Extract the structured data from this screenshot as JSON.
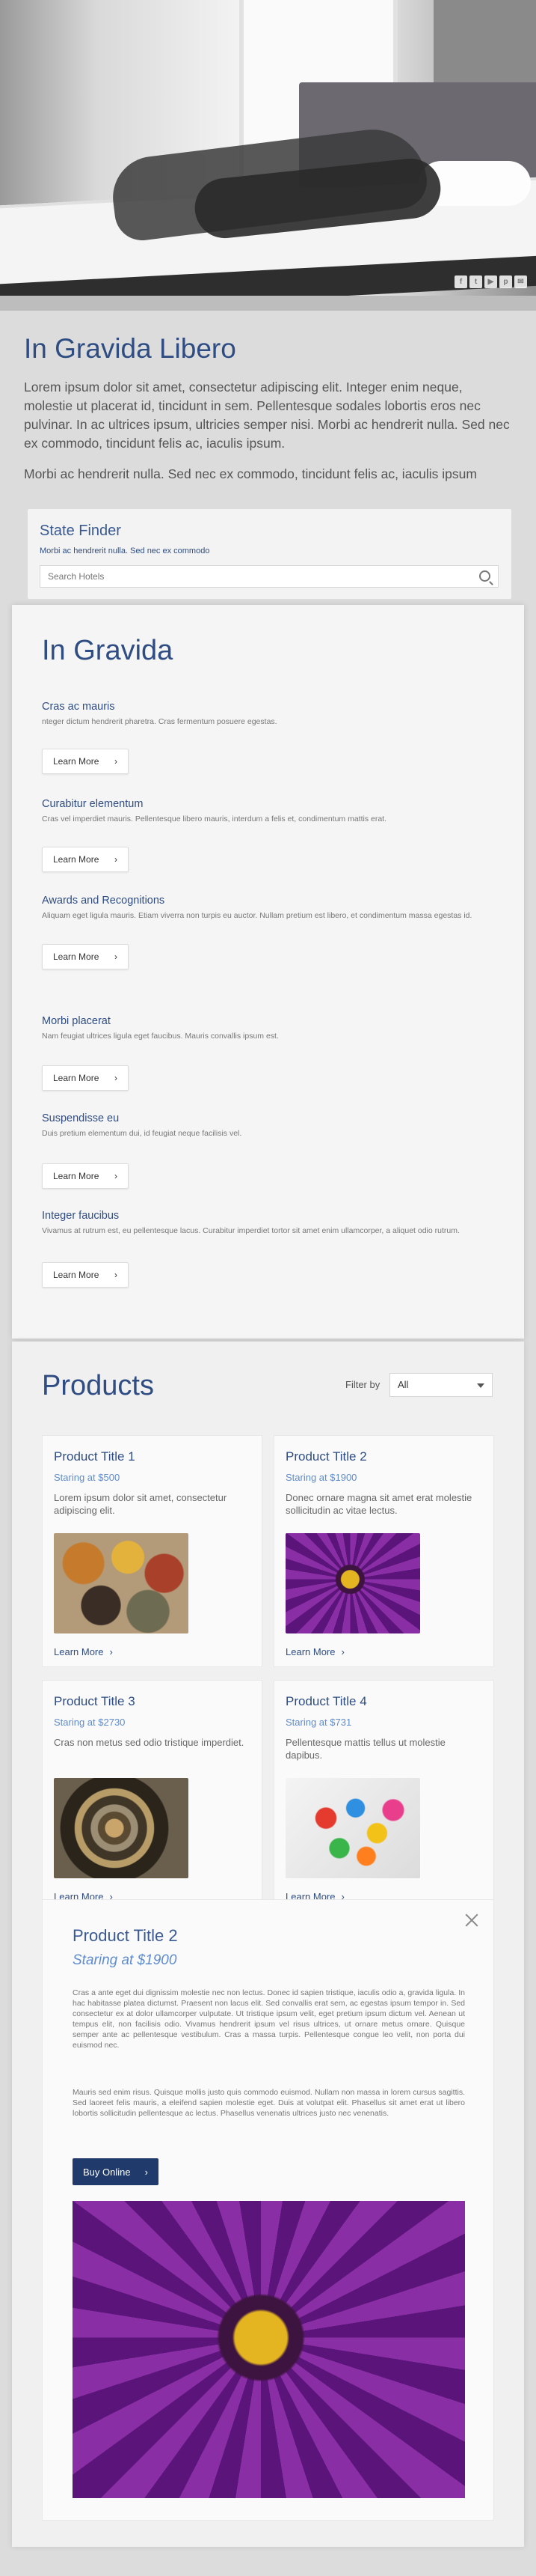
{
  "hero": {
    "social_icons": [
      "facebook-icon",
      "twitter-icon",
      "youtube-icon",
      "pinterest-icon",
      "email-icon"
    ],
    "social_glyphs": [
      "f",
      "t",
      "▶",
      "p",
      "✉"
    ]
  },
  "intro": {
    "title": "In Gravida Libero",
    "paragraph1": "Lorem ipsum dolor sit amet, consectetur adipiscing elit. Integer enim neque, molestie ut placerat id, tincidunt in sem. Pellentesque sodales lobortis eros nec pulvinar. In ac ultrices ipsum, ultricies semper nisi. Morbi ac hendrerit nulla. Sed nec ex commodo, tincidunt felis ac, iaculis ipsum.",
    "paragraph2": "Morbi ac hendrerit nulla. Sed nec ex commodo, tincidunt felis ac, iaculis ipsum"
  },
  "state_finder": {
    "title": "State Finder",
    "subtitle": "Morbi ac hendrerit nulla. Sed nec ex commodo",
    "placeholder": "Search Hotels"
  },
  "gravida": {
    "title": "In Gravida",
    "learn_more": "Learn More",
    "items": [
      {
        "title": "Cras ac mauris",
        "desc": "nteger dictum hendrerit pharetra. Cras fermentum posuere egestas."
      },
      {
        "title": "Curabitur elementum",
        "desc": "Cras vel imperdiet mauris. Pellentesque libero mauris, interdum a felis et, condimentum mattis erat."
      },
      {
        "title": "Awards and Recognitions",
        "desc": "Aliquam eget ligula mauris. Etiam viverra non turpis eu auctor. Nullam pretium est libero, et condimentum massa egestas id."
      },
      {
        "title": "Morbi placerat",
        "desc": "Nam feugiat ultrices ligula eget faucibus. Mauris convallis ipsum est."
      },
      {
        "title": "Suspendisse eu",
        "desc": "Duis pretium elementum dui, id feugiat neque facilisis vel."
      },
      {
        "title": "Integer faucibus",
        "desc": "Vivamus at rutrum est, eu pellentesque lacus. Curabitur imperdiet tortor sit amet enim ullamcorper, a aliquet odio rutrum."
      }
    ]
  },
  "products": {
    "title": "Products",
    "filter_label": "Filter by",
    "filter_value": "All",
    "learn_more": "Learn More",
    "items": [
      {
        "title": "Product Title 1",
        "price": "Staring at $500",
        "desc": "Lorem ipsum dolor sit amet, consectetur adipiscing elit.",
        "image": "spices"
      },
      {
        "title": "Product Title 2",
        "price": "Staring at $1900",
        "desc": "Donec ornare magna sit amet erat molestie sollicitudin ac vitae lectus.",
        "image": "purple-flower"
      },
      {
        "title": "Product Title 3",
        "price": "Staring at $2730",
        "desc": "Cras non metus sed odio tristique imperdiet.",
        "image": "watch-gears"
      },
      {
        "title": "Product Title 4",
        "price": "Staring at $731",
        "desc": "Pellentesque mattis tellus ut molestie dapibus.",
        "image": "colorful-candy"
      }
    ],
    "detail": {
      "title": "Product Title 2",
      "price": "Staring at $1900",
      "paragraph1": "Cras a ante eget dui dignissim molestie nec non lectus. Donec id sapien tristique, iaculis odio a, gravida ligula. In hac habitasse platea dictumst. Praesent non lacus elit. Sed convallis erat sem, ac egestas ipsum tempor in. Sed consectetur ex at dolor ullamcorper vulputate. Ut tristique ipsum velit, eget pretium ipsum dictum vel. Aenean ut tempus elit, non facilisis odio. Vivamus hendrerit ipsum vel risus ultrices, ut ornare metus ornare. Quisque semper ante ac pellentesque vestibulum. Cras a massa turpis. Pellentesque congue leo velit, non porta dui euismod nec.",
      "paragraph2": "Mauris sed enim risus. Quisque mollis justo quis commodo euismod. Nullam non massa in lorem cursus sagittis. Sed laoreet felis mauris, a eleifend sapien molestie eget. Duis at volutpat elit. Phasellus sit amet erat ut libero lobortis sollicitudin pellentesque ac lectus. Phasellus venenatis ultrices justo nec venenatis.",
      "buy_label": "Buy Online",
      "image": "purple-flower"
    }
  }
}
